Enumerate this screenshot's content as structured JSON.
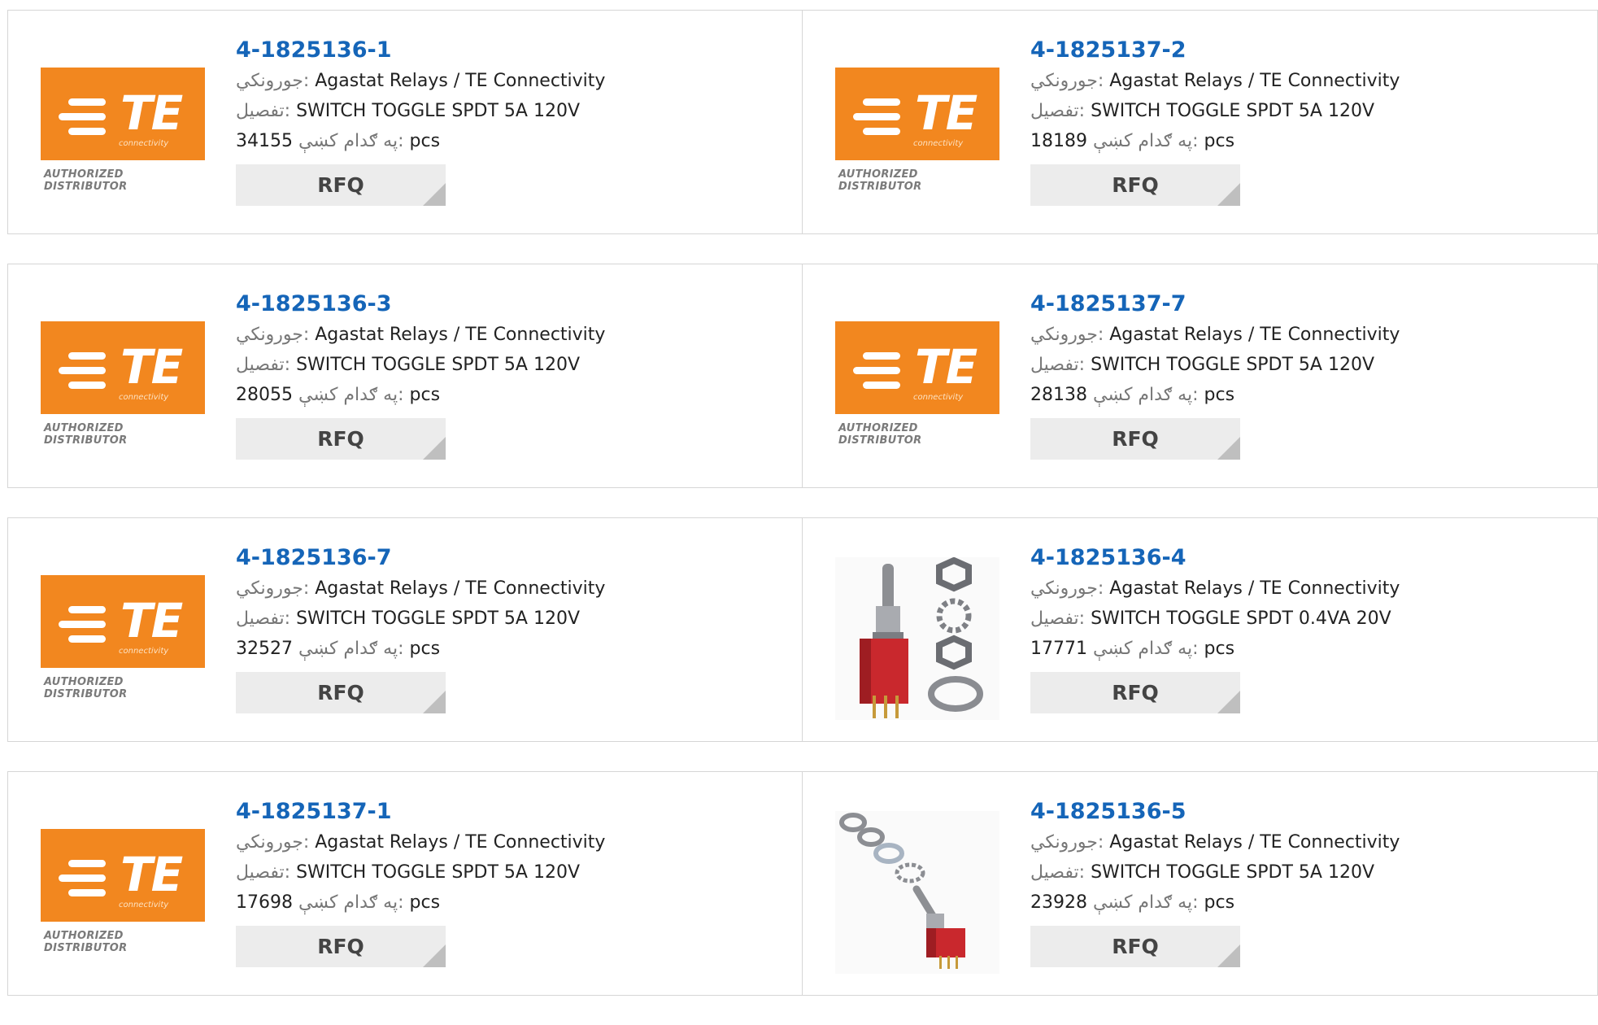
{
  "labels": {
    "manufacturer": "جورونكي:",
    "description": "تفصيل:",
    "stock": "په ګدام کښې:",
    "unit": "pcs",
    "rfq": "RFQ"
  },
  "brand_logo": {
    "text": "TE",
    "subtitle": "connectivity",
    "tagline": "AUTHORIZED DISTRIBUTOR",
    "color": "#f2871f"
  },
  "products": [
    {
      "part": "4-1825136-1",
      "manufacturer": "Agastat Relays / TE Connectivity",
      "description": "SWITCH TOGGLE SPDT 5A 120V",
      "stock": "34155",
      "image": "te-logo"
    },
    {
      "part": "4-1825137-2",
      "manufacturer": "Agastat Relays / TE Connectivity",
      "description": "SWITCH TOGGLE SPDT 5A 120V",
      "stock": "18189",
      "image": "te-logo"
    },
    {
      "part": "4-1825136-3",
      "manufacturer": "Agastat Relays / TE Connectivity",
      "description": "SWITCH TOGGLE SPDT 5A 120V",
      "stock": "28055",
      "image": "te-logo"
    },
    {
      "part": "4-1825137-7",
      "manufacturer": "Agastat Relays / TE Connectivity",
      "description": "SWITCH TOGGLE SPDT 5A 120V",
      "stock": "28138",
      "image": "te-logo"
    },
    {
      "part": "4-1825136-7",
      "manufacturer": "Agastat Relays / TE Connectivity",
      "description": "SWITCH TOGGLE SPDT 5A 120V",
      "stock": "32527",
      "image": "te-logo"
    },
    {
      "part": "4-1825136-4",
      "manufacturer": "Agastat Relays / TE Connectivity",
      "description": "SWITCH TOGGLE SPDT 0.4VA 20V",
      "stock": "17771",
      "image": "toggle-switch-photo"
    },
    {
      "part": "4-1825137-1",
      "manufacturer": "Agastat Relays / TE Connectivity",
      "description": "SWITCH TOGGLE SPDT 5A 120V",
      "stock": "17698",
      "image": "te-logo"
    },
    {
      "part": "4-1825136-5",
      "manufacturer": "Agastat Relays / TE Connectivity",
      "description": "SWITCH TOGGLE SPDT 5A 120V",
      "stock": "23928",
      "image": "toggle-switch-angled-photo"
    }
  ]
}
